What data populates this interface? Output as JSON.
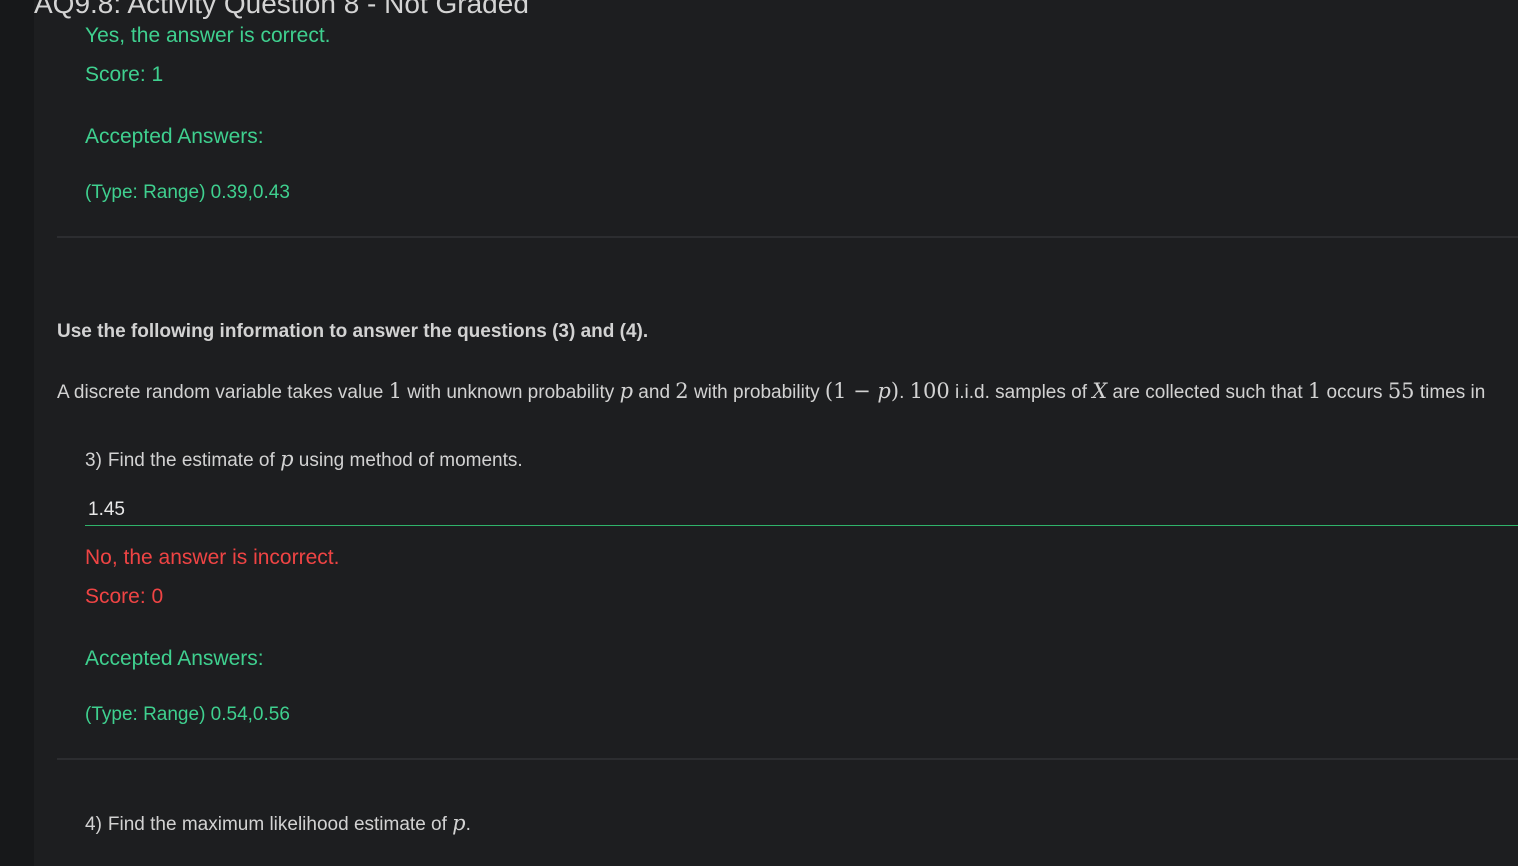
{
  "page_title": "AQ9.8: Activity Question 8 - Not Graded",
  "colors": {
    "correct": "#3fd08f",
    "incorrect": "#ef4444",
    "background": "#1d1e20",
    "input_border": "#2fb36a"
  },
  "q2_feedback": {
    "status": "Yes, the answer is correct.",
    "score": "Score: 1",
    "accepted_label": "Accepted Answers:",
    "accepted_value": "(Type: Range) 0.39,0.43"
  },
  "instruction": "Use the following information to answer the questions (3) and (4).",
  "problem": {
    "p1": "A discrete random variable takes value ",
    "m1": "1",
    "p2": " with unknown probability ",
    "m2": "p",
    "p3": " and ",
    "m3": "2",
    "p4": " with probability ",
    "m4": "(1 − ",
    "m5": "p",
    "m6": ")",
    "p5": ". ",
    "m7": "100",
    "p6": " i.i.d. samples of ",
    "m8": "X",
    "p7": " are collected such that ",
    "m9": "1",
    "p8": " occurs ",
    "m10": "55",
    "p9": " times in"
  },
  "q3": {
    "number": "3)",
    "text_before": "Find the estimate of ",
    "var": "p",
    "text_after": " using method of moments.",
    "input_value": "1.45",
    "status": "No, the answer is incorrect.",
    "score": "Score: 0",
    "accepted_label": "Accepted Answers:",
    "accepted_value": "(Type: Range) 0.54,0.56"
  },
  "q4": {
    "number": "4)",
    "text_before": "Find the maximum likelihood estimate of ",
    "var": "p",
    "text_after": "."
  }
}
